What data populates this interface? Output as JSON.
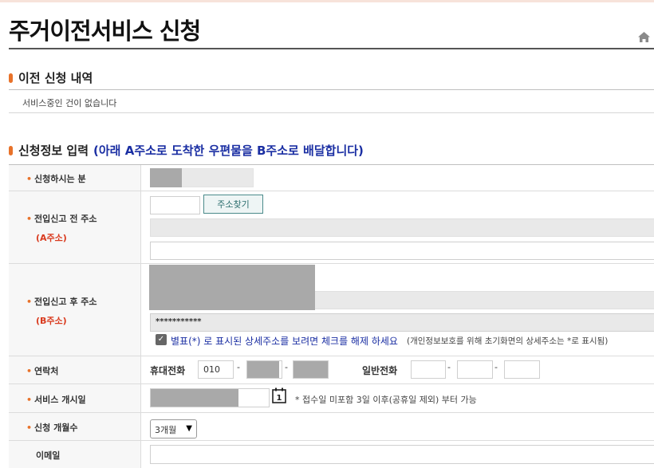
{
  "page": {
    "title": "주거이전서비스 신청"
  },
  "prev_section": {
    "heading": "이전 신청 내역",
    "empty_message": "서비스중인 건이 없습니다"
  },
  "form_section": {
    "heading": "신청정보 입력",
    "subheading": "(아래 A주소로 도착한 우편물을 B주소로 배달합니다)"
  },
  "fields": {
    "applicant": {
      "label": "신청하시는 분"
    },
    "old_address": {
      "label": "전입신고 전 주소",
      "sublabel": "(A주소)",
      "find_button": "주소찾기",
      "zipcode": "",
      "detail": ""
    },
    "new_address": {
      "label": "전입신고 후 주소",
      "sublabel": "(B주소)",
      "masked_detail": "***********",
      "checkbox_checked": true,
      "checkbox_label": "별표(*) 로 표시된 상세주소를 보려면 체크를 해제 하세요",
      "checkbox_note": "(개인정보보호를 위해 초기화면의 상세주소는 *로 표시됨)"
    },
    "contact": {
      "label": "연락처",
      "mobile_label": "휴대전화",
      "mobile_prefix": "010",
      "dash": "-",
      "landline_label": "일반전화"
    },
    "start_date": {
      "label": "서비스 개시일",
      "calendar_day": "1",
      "note": "* 접수일 미포함 3일 이후(공휴일 제외) 부터 가능"
    },
    "months": {
      "label": "신청 개월수",
      "selected": "3개월"
    },
    "email": {
      "label": "이메일"
    }
  },
  "icons": {
    "home": "home-icon",
    "calendar": "calendar-icon",
    "checkbox": "check-icon",
    "select": "chevron-down-icon"
  },
  "colors": {
    "accent": "#e8722a",
    "subheading": "#1b2fa3",
    "required_sublabel": "#d93a1e",
    "button_border": "#4b8b8b"
  }
}
